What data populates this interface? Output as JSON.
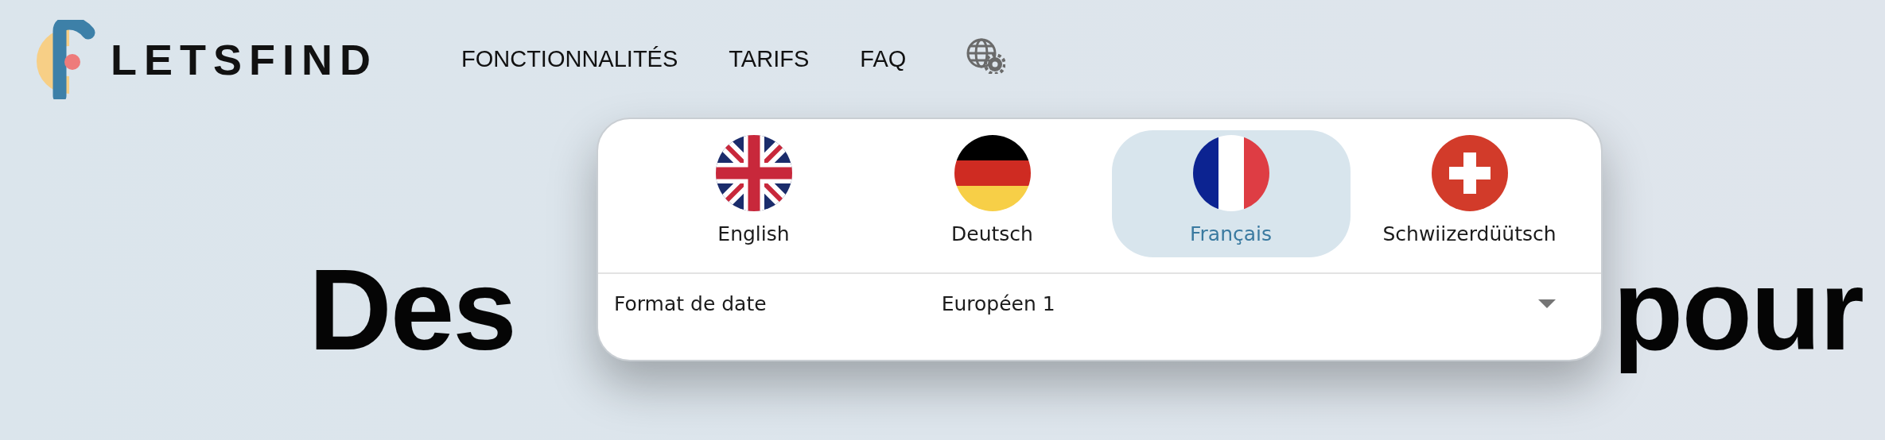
{
  "brand": "LETSFIND",
  "nav": [
    {
      "label": "FONCTIONNALITÉS"
    },
    {
      "label": "TARIFS"
    },
    {
      "label": "FAQ"
    }
  ],
  "headline": {
    "left": "Des",
    "right": "pour"
  },
  "language_menu": {
    "languages": [
      {
        "label": "English",
        "kind": "uk",
        "selected": false
      },
      {
        "label": "Deutsch",
        "kind": "de",
        "selected": false
      },
      {
        "label": "Français",
        "kind": "fr",
        "selected": true
      },
      {
        "label": "Schwiizerdüütsch",
        "kind": "ch",
        "selected": false
      }
    ],
    "date_format": {
      "label": "Format de date",
      "value": "Européen 1"
    }
  }
}
